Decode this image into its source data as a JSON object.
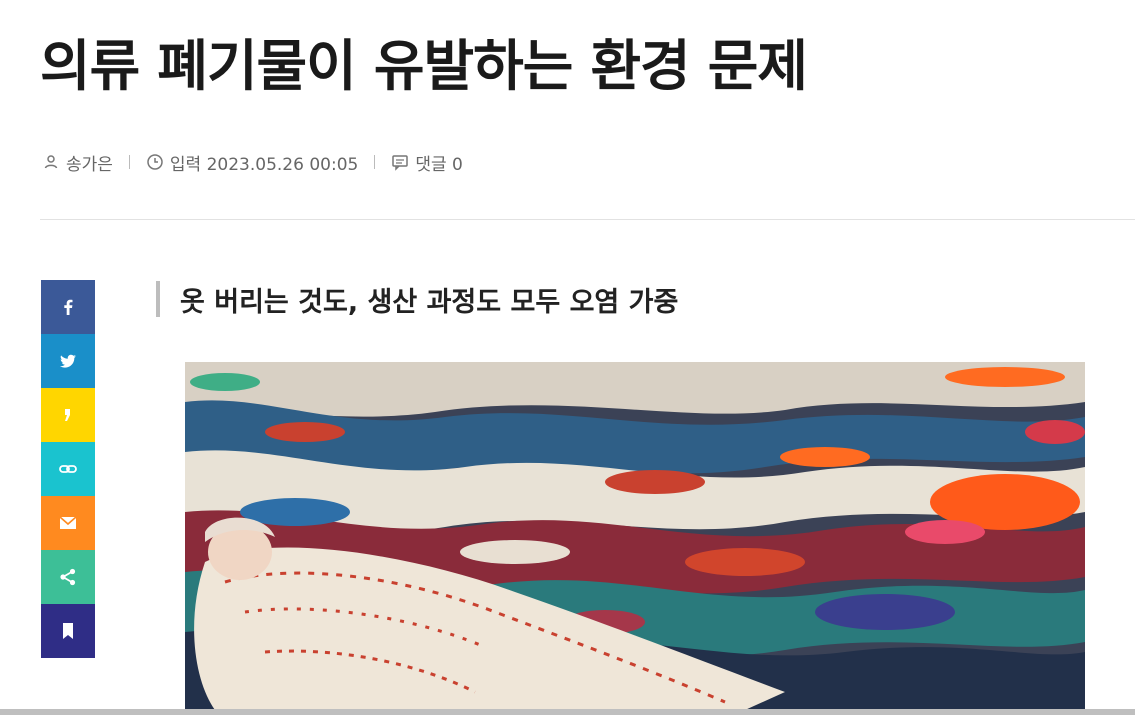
{
  "article": {
    "headline": "의류 폐기물이 유발하는 환경 문제",
    "subtitle": "옷 버리는 것도, 생산 과정도 모두 오염 가중",
    "meta": {
      "author": "송가은",
      "published": "입력 2023.05.26 00:05",
      "comments": "댓글 0"
    }
  },
  "share": {
    "buttons": [
      {
        "name": "facebook",
        "icon": "facebook-icon",
        "color": "#3b5998"
      },
      {
        "name": "twitter",
        "icon": "twitter-icon",
        "color": "#1a8fc9"
      },
      {
        "name": "kakaostory",
        "icon": "kakaostory-icon",
        "color": "#ffd600"
      },
      {
        "name": "copy-link",
        "icon": "link-icon",
        "color": "#1ac3cf"
      },
      {
        "name": "email",
        "icon": "email-icon",
        "color": "#ff8a1f"
      },
      {
        "name": "more-share",
        "icon": "share-icon",
        "color": "#3dbf97"
      },
      {
        "name": "bookmark",
        "icon": "bookmark-icon",
        "color": "#2f2d86"
      }
    ]
  },
  "photo": {
    "subject": "pile-of-discarded-clothes-with-doll",
    "colors": [
      "#2f5f87",
      "#c9412f",
      "#e8e2d6",
      "#ff6b21",
      "#2a7a7c",
      "#8a2b3a"
    ]
  }
}
